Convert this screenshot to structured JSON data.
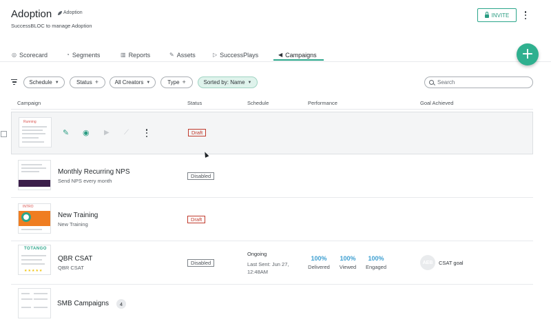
{
  "header": {
    "title": "Adoption",
    "tag": "Adoption",
    "subtitle": "SuccessBLOC to manage Adoption",
    "invite_label": "INVITE"
  },
  "tabs": [
    {
      "label": "Scorecard",
      "icon": "scorecard-icon"
    },
    {
      "label": "Segments",
      "icon": "segments-icon"
    },
    {
      "label": "Reports",
      "icon": "bar-chart-icon"
    },
    {
      "label": "Assets",
      "icon": "paperclip-icon"
    },
    {
      "label": "SuccessPlays",
      "icon": "play-icon"
    },
    {
      "label": "Campaigns",
      "icon": "megaphone-icon",
      "active": true
    }
  ],
  "filters": {
    "schedule": "Schedule",
    "status": "Status",
    "creators": "All Creators",
    "type": "Type",
    "sorted": "Sorted by: Name",
    "search_placeholder": "Search"
  },
  "columns": {
    "campaign": "Campaign",
    "status": "Status",
    "schedule": "Schedule",
    "performance": "Performance",
    "goal": "Goal Achieved"
  },
  "rows": [
    {
      "name": "",
      "subtitle": "",
      "status": "Draft",
      "thumb_text": "Running"
    },
    {
      "name": "Monthly Recurring NPS",
      "subtitle": "Send NPS every month",
      "status": "Disabled"
    },
    {
      "name": "New Training",
      "subtitle": "New Training",
      "status": "Draft",
      "thumb_text": "INTRO"
    },
    {
      "name": "QBR CSAT",
      "subtitle": "QBR CSAT",
      "status": "Disabled",
      "schedule_state": "Ongoing",
      "schedule_detail": "Last Sent: Jun 27, 12:48AM",
      "thumb_text": "TOTANGO",
      "performance": [
        {
          "value": "100%",
          "label": "Delivered"
        },
        {
          "value": "100%",
          "label": "Viewed"
        },
        {
          "value": "100%",
          "label": "Engaged"
        }
      ],
      "goal_avatar": "AEB",
      "goal_text": "CSAT goal"
    },
    {
      "name": "SMB Campaigns",
      "count": "4"
    }
  ],
  "colors": {
    "accent": "#2aa58a",
    "draft": "#c0392b",
    "performance": "#3e9fd1"
  }
}
